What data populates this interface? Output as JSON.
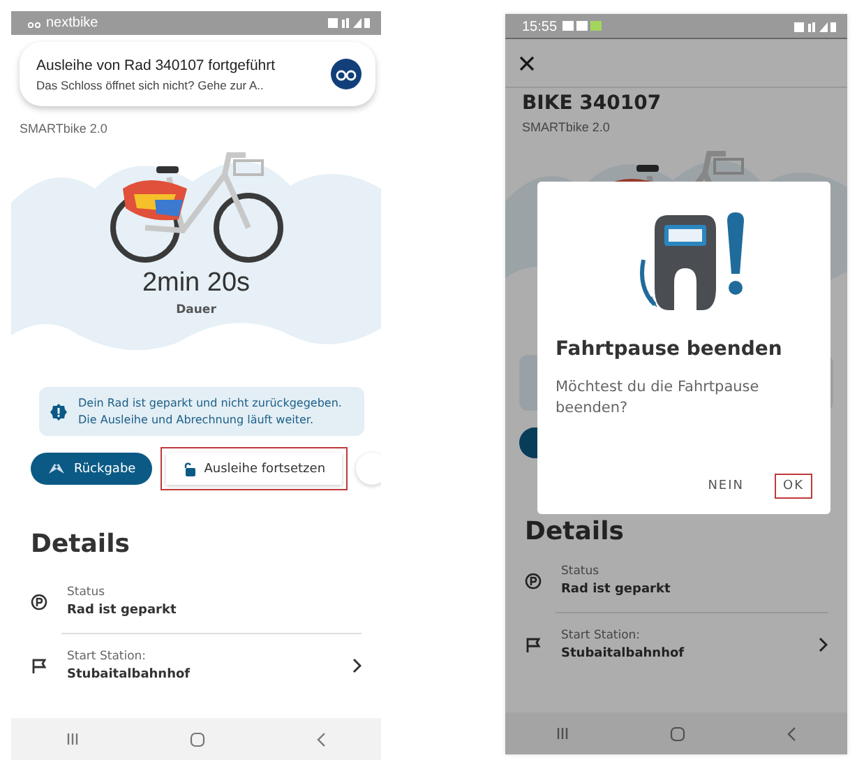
{
  "left_phone": {
    "status_bar": {
      "app": "nextbike"
    },
    "notification": {
      "title": "Ausleihe von Rad 340107 fortgeführt",
      "text": "Das Schloss öffnet sich nicht? Gehe zur A.."
    },
    "model": "SMARTbike 2.0",
    "duration": "2min 20s",
    "duration_label": "Dauer",
    "notice": "Dein Rad ist geparkt und nicht zurückgegeben. Die Ausleihe und Abrechnung läuft weiter.",
    "actions": [
      {
        "kind": "primary",
        "label": "Rückgabe",
        "highlighted": false
      },
      {
        "kind": "secondary",
        "label": "Ausleihe fortsetzen",
        "highlighted": true
      }
    ],
    "details_title": "Details",
    "details": [
      {
        "kind": "parking",
        "label": "Status",
        "value": "Rad ist geparkt",
        "chevron": false
      },
      {
        "kind": "flag",
        "label": "Start Station:",
        "value": "Stubaitalbahnhof",
        "chevron": true
      }
    ]
  },
  "right_phone": {
    "status_bar": {
      "time": "15:55"
    },
    "title": "BIKE 340107",
    "model": "SMARTbike 2.0",
    "dialog": {
      "title": "Fahrtpause beenden",
      "text": "Möchtest du die Fahrtpause beenden?",
      "buttons": [
        {
          "label": "NEIN",
          "highlighted": false
        },
        {
          "label": "OK",
          "highlighted": true
        }
      ]
    },
    "details_title": "Details",
    "details": [
      {
        "kind": "parking",
        "label": "Status",
        "value": "Rad ist geparkt",
        "chevron": false
      },
      {
        "kind": "flag",
        "label": "Start Station:",
        "value": "Stubaitalbahnhof",
        "chevron": true
      }
    ]
  }
}
